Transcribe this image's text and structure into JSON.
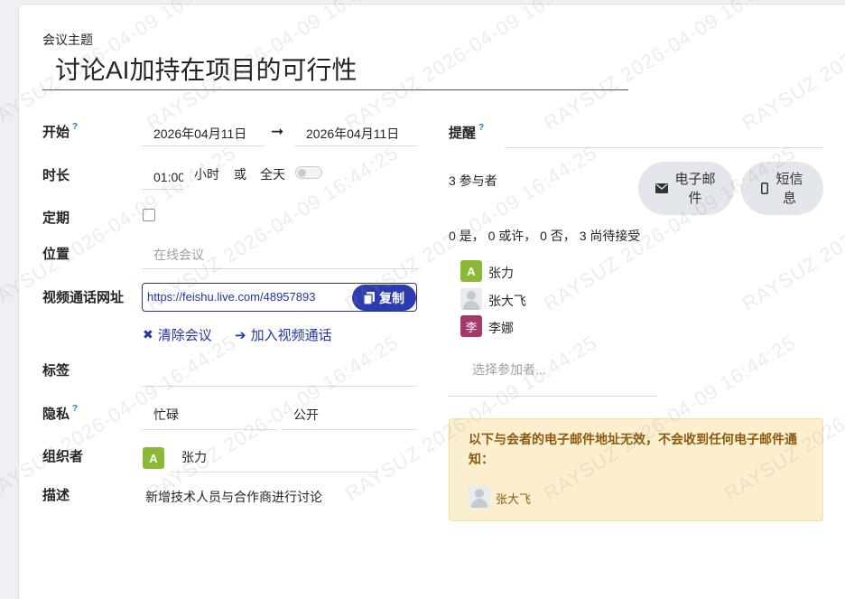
{
  "form": {
    "subject_label": "会议主题",
    "subject_value": "讨论AI加持在项目的可行性",
    "start_label": "开始",
    "help_mark": "?",
    "start_date": "2026年04月11日",
    "arrow": "➞",
    "end_date": "2026年04月11日",
    "duration_label": "时长",
    "duration_value": "01:00",
    "hours_unit": "小时",
    "or_text": "或",
    "allday_label": "全天",
    "recurrence_label": "定期",
    "location_label": "位置",
    "location_placeholder": "在线会议",
    "video_label": "视频通话网址",
    "video_url": "https://feishu.live.com/48957893",
    "copy_label": "复制",
    "clear_meeting_label": "清除会议",
    "join_video_label": "加入视频通话",
    "tags_label": "标签",
    "privacy_label": "隐私",
    "privacy_value1": "忙碌",
    "privacy_value2": "公开",
    "organizer_label": "组织者",
    "organizer_initial": "A",
    "organizer_name": "张力",
    "description_label": "描述",
    "description_value": "新增技术人员与合作商进行讨论"
  },
  "right": {
    "reminder_label": "提醒",
    "attendee_count": "3 参与者",
    "email_button": "电子邮件",
    "sms_button": "短信息",
    "status_summary": "0 是， 0 或许， 0 否， 3 尚待接受",
    "attendees": [
      {
        "initial": "A",
        "name": "张力",
        "color": "#8bb935"
      },
      {
        "initial": "",
        "name": "张大飞",
        "color": "#e9ecef"
      },
      {
        "initial": "李",
        "name": "李娜",
        "color": "#a5396c"
      }
    ],
    "select_attendee_placeholder": "选择参加者...",
    "warning_text": "以下与会者的电子邮件地址无效，不会收到任何电子邮件通知：",
    "warning_person": "张大飞"
  },
  "watermark_text": "RAYSUZ 2026-04-09 16:44:25",
  "colors": {
    "primary": "#2d3bb0",
    "link": "#2435a0",
    "warning_bg": "#fcefcf",
    "warning_text": "#8a5a10"
  }
}
